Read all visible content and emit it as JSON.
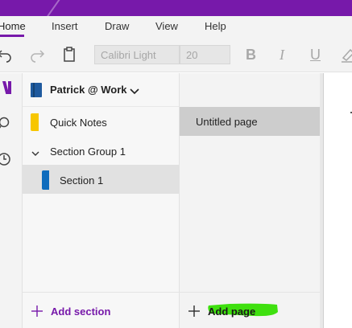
{
  "menu": {
    "items": [
      "Home",
      "Insert",
      "Draw",
      "View",
      "Help"
    ],
    "active": "Home"
  },
  "toolbar": {
    "font_name": "Calibri Light",
    "font_size": "20",
    "bold": "B",
    "italic": "I",
    "underline": "U"
  },
  "notebook": {
    "name": "Patrick @ Work"
  },
  "sections": [
    {
      "label": "Quick Notes",
      "color": "#f7c600",
      "kind": "section"
    },
    {
      "label": "Section Group 1",
      "kind": "group",
      "expanded": true
    },
    {
      "label": "Section 1",
      "color": "#0f6cbd",
      "kind": "section",
      "selected": true
    }
  ],
  "pages": [
    {
      "label": "Untitled page",
      "selected": true
    }
  ],
  "actions": {
    "add_section": "Add section",
    "add_page": "Add page"
  },
  "colors": {
    "accent": "#7719aa",
    "highlight": "#3fe00f"
  }
}
